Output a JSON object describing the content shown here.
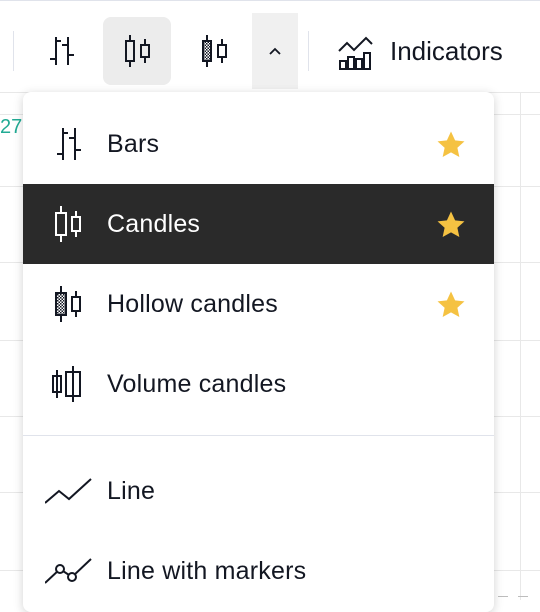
{
  "background": {
    "price_fragment": "27"
  },
  "toolbar": {
    "indicators_label": "Indicators",
    "buttons": [
      {
        "icon": "bars-icon",
        "active": false
      },
      {
        "icon": "candles-icon",
        "active": true
      },
      {
        "icon": "hollow-candles-icon",
        "active": false
      },
      {
        "icon": "chevron-up-icon",
        "active": false
      }
    ]
  },
  "chart_type_menu": {
    "items": [
      {
        "label": "Bars",
        "icon": "bars-icon",
        "favorite": true,
        "selected": false
      },
      {
        "label": "Candles",
        "icon": "candles-icon",
        "favorite": true,
        "selected": true
      },
      {
        "label": "Hollow candles",
        "icon": "hollow-candles-icon",
        "favorite": true,
        "selected": false
      },
      {
        "label": "Volume candles",
        "icon": "volume-candles-icon",
        "favorite": false,
        "selected": false
      },
      {
        "label": "Line",
        "icon": "line-icon",
        "favorite": false,
        "selected": false
      },
      {
        "label": "Line with markers",
        "icon": "line-markers-icon",
        "favorite": false,
        "selected": false
      }
    ]
  },
  "colors": {
    "selected_bg": "#2a2a2a",
    "star": "#f5c242",
    "price_green": "#22ab94"
  }
}
